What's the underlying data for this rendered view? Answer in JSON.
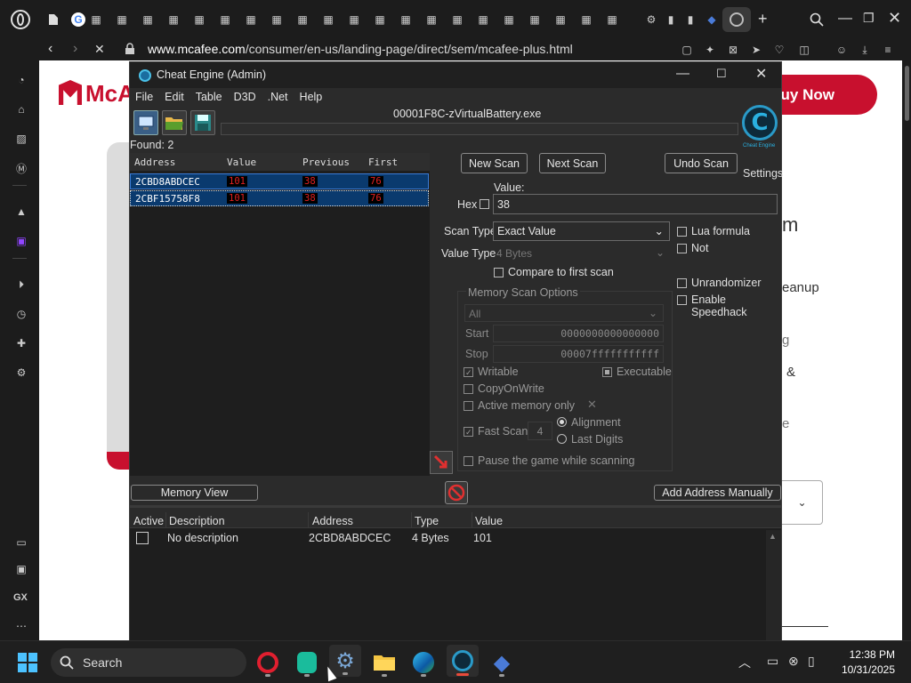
{
  "browser": {
    "url_host": "www.mcafee.com",
    "url_path": "/consumer/en-us/landing-page/direct/sem/mcafee-plus.html"
  },
  "website": {
    "logo_text": "McA",
    "cta_button": "Buy Now",
    "frag_1": "m",
    "frag_2": "eanup",
    "frag_3": "g",
    "frag_4": "&",
    "frag_5": "e"
  },
  "cheat_engine": {
    "title": "Cheat Engine (Admin)",
    "menu": [
      "File",
      "Edit",
      "Table",
      "D3D",
      ".Net",
      "Help"
    ],
    "process": "00001F8C-zVirtualBattery.exe",
    "found": "Found: 2",
    "results_headers": [
      "Address",
      "Value",
      "Previous",
      "First"
    ],
    "results": [
      {
        "address": "2CBD8ABDCEC",
        "value": "101",
        "previous": "38",
        "first": "76"
      },
      {
        "address": "2CBF15758F8",
        "value": "101",
        "previous": "38",
        "first": "76"
      }
    ],
    "buttons": {
      "new_scan": "New Scan",
      "next_scan": "Next Scan",
      "undo_scan": "Undo Scan",
      "settings": "Settings",
      "memory_view": "Memory View",
      "add_address": "Add Address Manually"
    },
    "logo_text": "Cheat Engine",
    "value_label": "Value:",
    "hex_label": "Hex",
    "value_input": "38",
    "scan_type_label": "Scan Type",
    "scan_type_value": "Exact Value",
    "value_type_label": "Value Type",
    "value_type_value": "4 Bytes",
    "compare_first": "Compare to first scan",
    "lua_formula": "Lua formula",
    "not_label": "Not",
    "unrandomizer": "Unrandomizer",
    "speedhack": "Enable Speedhack",
    "memory_scan_options": "Memory Scan Options",
    "mem_region": "All",
    "start_label": "Start",
    "start_value": "0000000000000000",
    "stop_label": "Stop",
    "stop_value": "00007fffffffffff",
    "writable": "Writable",
    "executable": "Executable",
    "copy_on_write": "CopyOnWrite",
    "active_memory_only": "Active memory only",
    "fast_scan": "Fast Scan",
    "fast_scan_value": "4",
    "alignment": "Alignment",
    "last_digits": "Last Digits",
    "pause_game": "Pause the game while scanning",
    "table_headers": [
      "Active",
      "Description",
      "Address",
      "Type",
      "Value"
    ],
    "table_rows": [
      {
        "description": "No description",
        "address": "2CBD8ABDCEC",
        "type": "4 Bytes",
        "value": "101"
      }
    ]
  },
  "taskbar": {
    "search_label": "Search",
    "time": "12:38 PM",
    "date": "10/31/2025"
  },
  "colors": {
    "accent_red": "#c8102e",
    "selection_blue": "#0a3a6e",
    "ce_background": "#2b2b2b"
  }
}
